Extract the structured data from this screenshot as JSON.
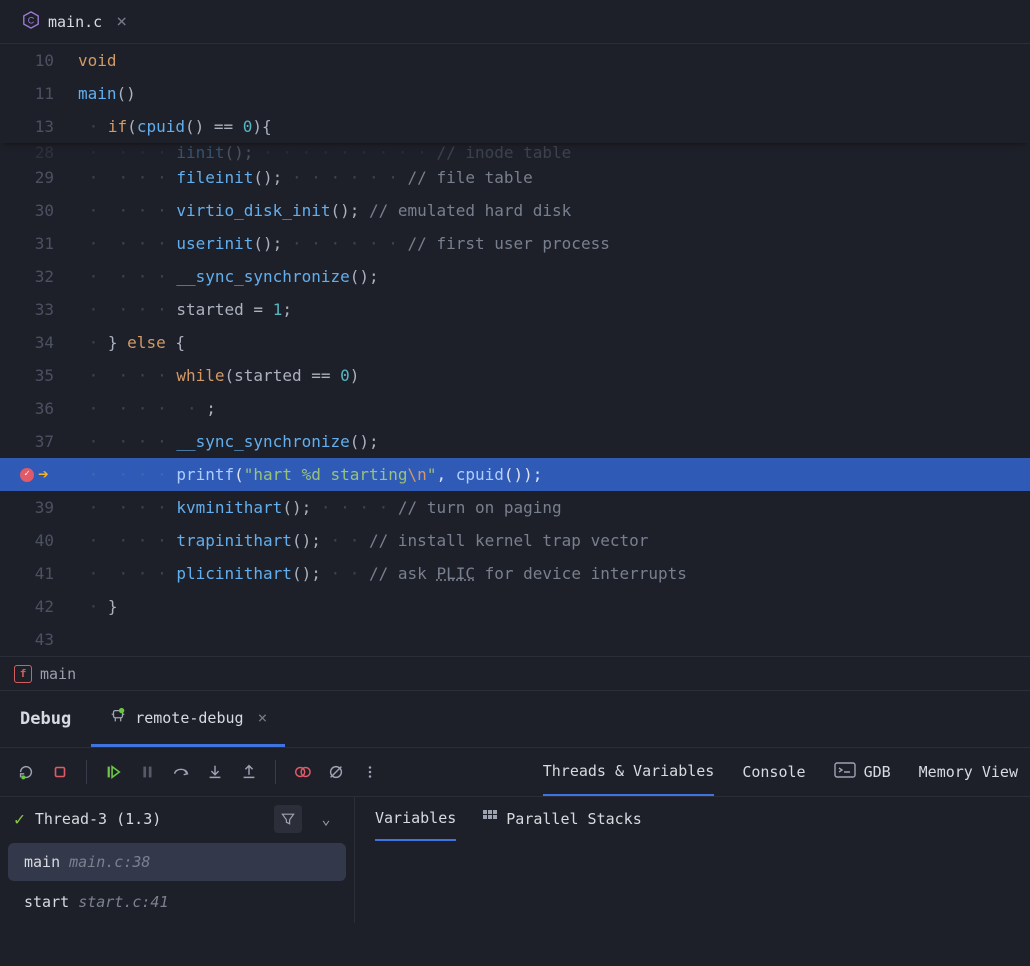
{
  "tab": {
    "filename": "main.c"
  },
  "code": {
    "l10": {
      "num": "10",
      "t1": "void"
    },
    "l11": {
      "num": "11",
      "t1": "main",
      "t2": "()"
    },
    "l13": {
      "num": "13",
      "t1": "if",
      "t2": "(",
      "t3": "cpuid",
      "t4": "() == ",
      "t5": "0",
      "t6": "){"
    },
    "l28": {
      "num": "28",
      "call": "iinit",
      "rest": "();",
      "comment": "// inode table"
    },
    "l29": {
      "num": "29",
      "call": "fileinit",
      "rest": "();",
      "comment": "// file table"
    },
    "l30": {
      "num": "30",
      "call": "virtio_disk_init",
      "rest": "();",
      "comment": "// emulated hard disk"
    },
    "l31": {
      "num": "31",
      "call": "userinit",
      "rest": "();",
      "comment": "// first user process"
    },
    "l32": {
      "num": "32",
      "call": "__sync_synchronize",
      "rest": "();"
    },
    "l33": {
      "num": "33",
      "t1": "started",
      "t2": " = ",
      "t3": "1",
      "t4": ";"
    },
    "l34": {
      "num": "34",
      "t1": "} ",
      "t2": "else",
      "t3": " {"
    },
    "l35": {
      "num": "35",
      "t1": "while",
      "t2": "(",
      "t3": "started",
      "t4": " == ",
      "t5": "0",
      "t6": ")"
    },
    "l36": {
      "num": "36",
      "t1": ";"
    },
    "l37": {
      "num": "37",
      "call": "__sync_synchronize",
      "rest": "();"
    },
    "l38": {
      "call": "printf",
      "p1": "(",
      "s1": "\"hart %d starting",
      "esc": "\\n",
      "s2": "\"",
      "p2": ", ",
      "c2": "cpuid",
      "p3": "());"
    },
    "l39": {
      "num": "39",
      "call": "kvminithart",
      "rest": "();",
      "comment": "// turn on paging"
    },
    "l40": {
      "num": "40",
      "call": "trapinithart",
      "rest": "();",
      "comment": "// install kernel trap vector"
    },
    "l41": {
      "num": "41",
      "call": "plicinithart",
      "rest": "();",
      "c1": "// ask ",
      "cu": "PLIC",
      "c2": " for device interrupts"
    },
    "l42": {
      "num": "42",
      "t1": "}"
    },
    "l43": {
      "num": "43"
    }
  },
  "breadcrumb": {
    "fn": "main"
  },
  "debug": {
    "title": "Debug",
    "config": "remote-debug",
    "maintabs": {
      "threads": "Threads & Variables",
      "console": "Console",
      "gdb": "GDB",
      "memory": "Memory View"
    },
    "thread": "Thread-3 (1.3)",
    "subtabs": {
      "variables": "Variables",
      "stacks": "Parallel Stacks"
    },
    "frames": [
      {
        "fn": "main",
        "loc": "main.c:38"
      },
      {
        "fn": "start",
        "loc": "start.c:41"
      }
    ]
  }
}
